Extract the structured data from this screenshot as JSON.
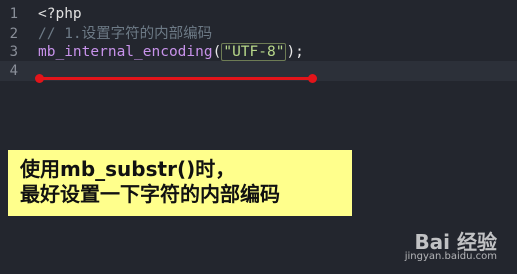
{
  "editor": {
    "lines": [
      {
        "number": "1",
        "php_open": "<?php"
      },
      {
        "number": "2",
        "comment": "// 1.设置字符的内部编码"
      },
      {
        "number": "3",
        "function": "mb_internal_encoding",
        "paren_open": "(",
        "string": "\"UTF-8\"",
        "paren_close": ");"
      },
      {
        "number": "4"
      }
    ]
  },
  "annotation": {
    "color": "#e3141a"
  },
  "note": {
    "line1": "使用mb_substr()时，",
    "line2": "最好设置一下字符的内部编码",
    "background": "#ffff8c"
  },
  "watermark": {
    "brand": "Bai  经验",
    "url": "jingyan.baidu.com"
  }
}
